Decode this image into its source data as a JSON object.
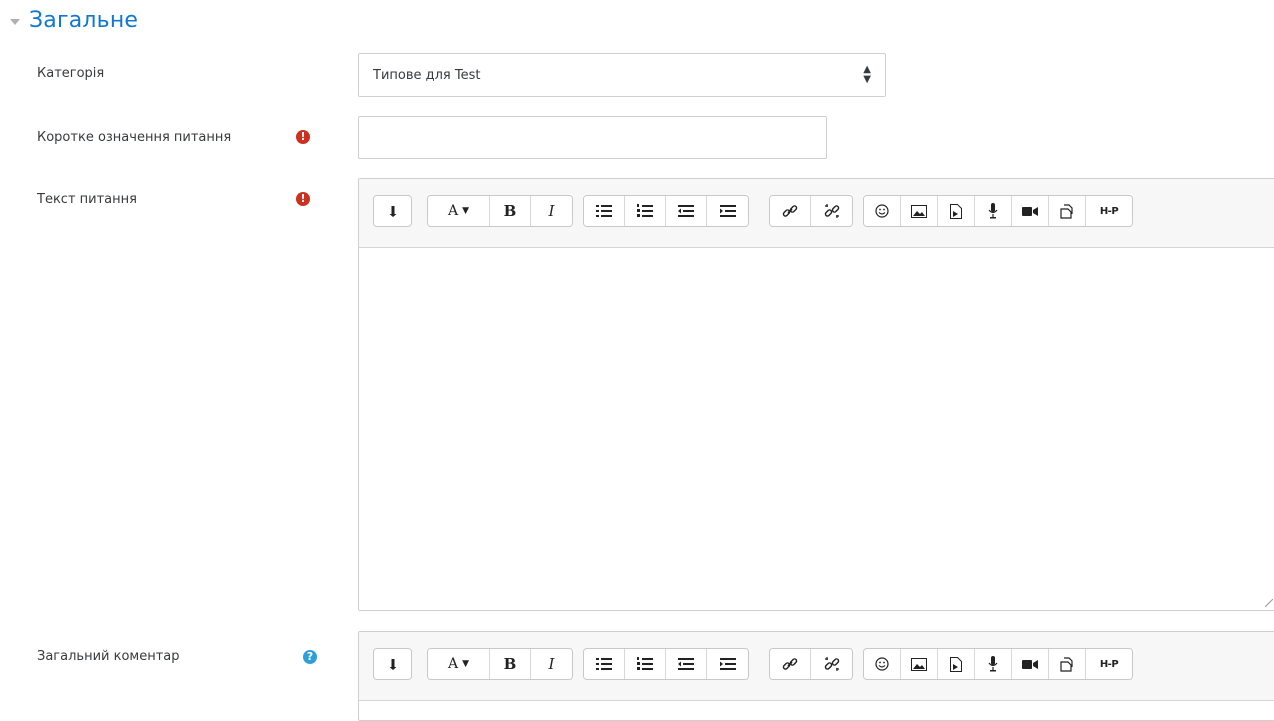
{
  "section": {
    "title": "Загальне"
  },
  "fields": {
    "category": {
      "label": "Категорія",
      "value": "Типове для Test"
    },
    "question_name": {
      "label": "Коротке означення питання",
      "value": ""
    },
    "question_text": {
      "label": "Текст питання",
      "value": ""
    },
    "general_feedback": {
      "label": "Загальний коментар",
      "value": ""
    }
  },
  "icons": {
    "required": "!",
    "help": "?",
    "select_arrows": "⬍"
  },
  "toolbar": {
    "show_more": "show-more-icon",
    "font_style": "A",
    "bold": "B",
    "italic": "I",
    "h5p": "H-P"
  },
  "colors": {
    "accent": "#1177d1",
    "required": "#ca3120",
    "help": "#2f9fd8"
  }
}
